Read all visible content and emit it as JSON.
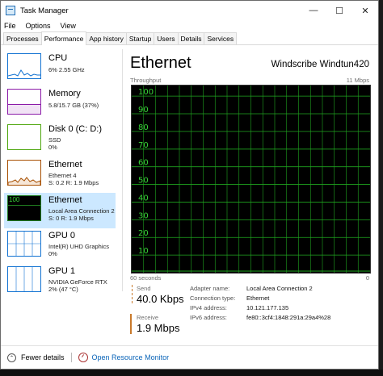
{
  "window": {
    "title": "Task Manager",
    "minimize": "—",
    "maximize": "☐",
    "close": "✕"
  },
  "menu": [
    "File",
    "Options",
    "View"
  ],
  "tabs": [
    "Processes",
    "Performance",
    "App history",
    "Startup",
    "Users",
    "Details",
    "Services"
  ],
  "active_tab": "Performance",
  "resources": [
    {
      "name": "CPU",
      "sub1": "6% 2.55 GHz",
      "sub2": "",
      "sub3": "",
      "color": "#1172d2"
    },
    {
      "name": "Memory",
      "sub1": "5.8/15.7 GB (37%)",
      "sub2": "",
      "sub3": "",
      "color": "#8b1aa8"
    },
    {
      "name": "Disk 0 (C: D:)",
      "sub1": "SSD",
      "sub2": "0%",
      "sub3": "",
      "color": "#4da60c"
    },
    {
      "name": "Ethernet",
      "sub1": "Ethernet 4",
      "sub2": "S: 0.2  R: 1.9 Mbps",
      "sub3": "",
      "color": "#a74f01"
    },
    {
      "name": "Ethernet",
      "sub1": "Local Area Connection 2",
      "sub2": "S: 0  R: 1.9 Mbps",
      "sub3": "",
      "color": "#a74f01",
      "thumb_label": "100"
    },
    {
      "name": "GPU 0",
      "sub1": "Intel(R) UHD Graphics",
      "sub2": "0%",
      "sub3": "",
      "color": "#1172d2"
    },
    {
      "name": "GPU 1",
      "sub1": "NVIDIA GeForce RTX",
      "sub2": "2% (47 °C)",
      "sub3": "",
      "color": "#1172d2"
    }
  ],
  "selected_resource": 4,
  "detail": {
    "title": "Ethernet",
    "adapter_name": "Windscribe Windtun420",
    "throughput_label": "Throughput",
    "max_label": "11 Mbps",
    "time_label": "60 seconds",
    "zero_label": "0",
    "y_ticks": [
      "100",
      "90",
      "80",
      "70",
      "60",
      "50",
      "40",
      "30",
      "20",
      "10"
    ],
    "grid_color": "#1fa51f",
    "send_label": "Send",
    "send_value": "40.0 Kbps",
    "receive_label": "Receive",
    "receive_value": "1.9 Mbps",
    "info": [
      {
        "k": "Adapter name:",
        "v": "Local Area Connection 2"
      },
      {
        "k": "Connection type:",
        "v": "Ethernet"
      },
      {
        "k": "IPv4 address:",
        "v": "10.121.177.135"
      },
      {
        "k": "IPv6 address:",
        "v": "fe80::3cf4:1848:291a:29a4%28"
      }
    ]
  },
  "footer": {
    "fewer_details": "Fewer details",
    "open_resmon": "Open Resource Monitor"
  }
}
